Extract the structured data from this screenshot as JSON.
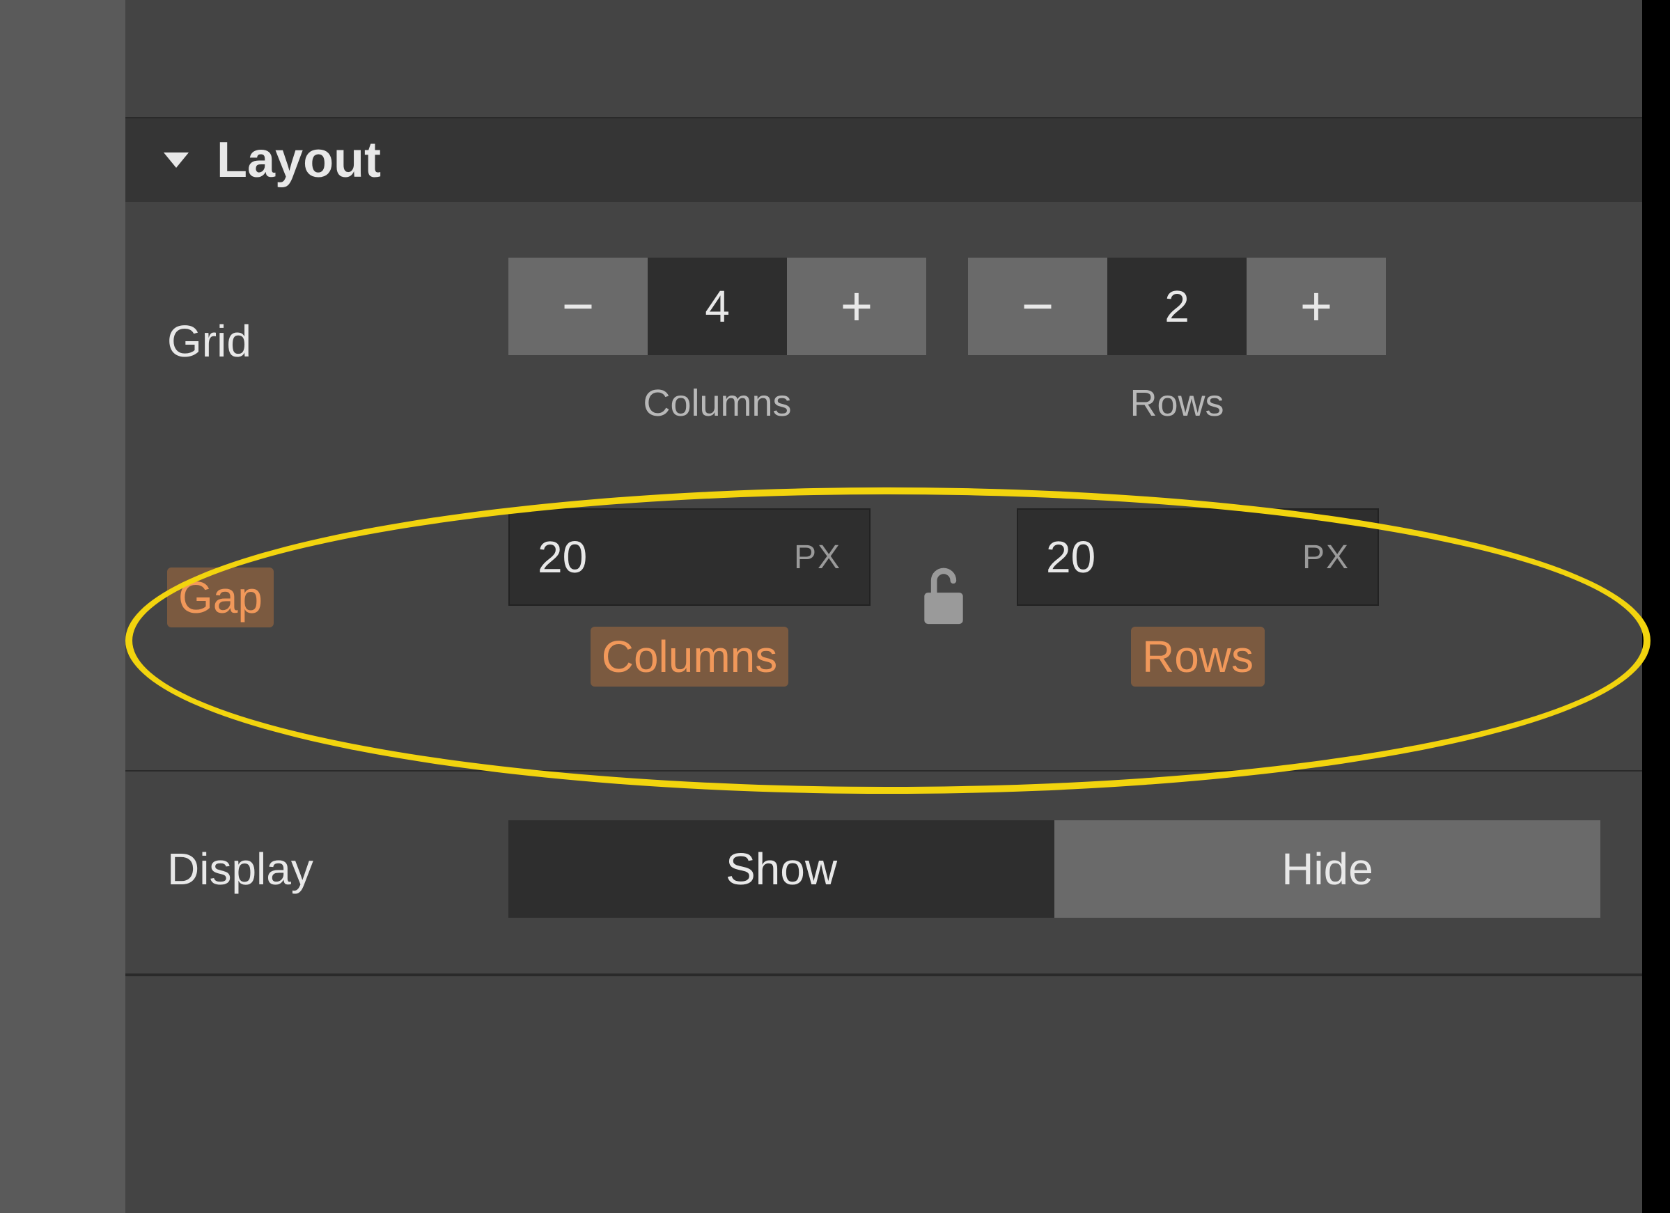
{
  "section": {
    "title": "Layout"
  },
  "grid": {
    "label": "Grid",
    "columns": {
      "value": "4",
      "caption": "Columns",
      "minus_glyph": "−",
      "plus_glyph": "+"
    },
    "rows": {
      "value": "2",
      "caption": "Rows",
      "minus_glyph": "−",
      "plus_glyph": "+"
    }
  },
  "gap": {
    "label": "Gap",
    "columns": {
      "value": "20",
      "unit": "PX",
      "caption": "Columns"
    },
    "rows": {
      "value": "20",
      "unit": "PX",
      "caption": "Rows"
    },
    "lock_state": "unlocked"
  },
  "display": {
    "label": "Display",
    "show_label": "Show",
    "hide_label": "Hide",
    "active": "show"
  },
  "colors": {
    "panel_bg": "#444444",
    "header_bg": "#353535",
    "input_bg": "#2e2e2e",
    "button_bg": "#6a6a6a",
    "text": "#e8e8e8",
    "muted_text": "#b8b8b8",
    "highlight_text": "#f1985a",
    "highlight_bg": "rgba(226,131,58,0.35)",
    "annotation": "#f2d40e"
  }
}
